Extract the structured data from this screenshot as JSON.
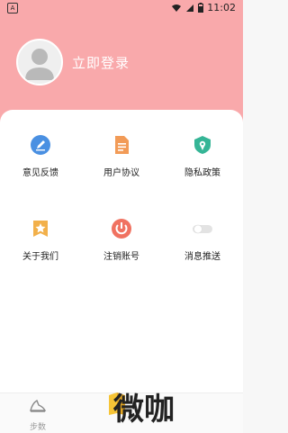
{
  "status": {
    "time": "11:02",
    "left_badge": "A"
  },
  "user": {
    "login_label": "立即登录"
  },
  "menu": [
    {
      "label": "意见反馈",
      "icon": "pencil-icon",
      "color": "#4a90e2"
    },
    {
      "label": "用户协议",
      "icon": "document-icon",
      "color": "#f29b57"
    },
    {
      "label": "隐私政策",
      "icon": "shield-location-icon",
      "color": "#35b596"
    },
    {
      "label": "关于我们",
      "icon": "star-badge-icon",
      "color": "#f2b04a"
    },
    {
      "label": "注销账号",
      "icon": "power-icon",
      "color": "#f07261"
    },
    {
      "label": "消息推送",
      "icon": "toggle-icon",
      "color": "#e3e3e3"
    }
  ],
  "tabbar": {
    "item_label": "步数"
  },
  "brand": {
    "text": "微咖"
  }
}
